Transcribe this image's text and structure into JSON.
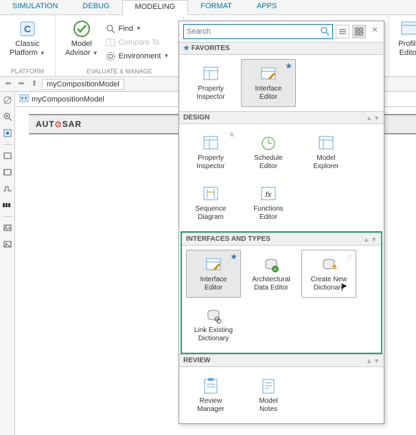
{
  "tabs": {
    "simulation": "SIMULATION",
    "debug": "DEBUG",
    "modeling": "MODELING",
    "format": "FORMAT",
    "apps": "APPS"
  },
  "ribbon": {
    "platform": {
      "classic": "Classic",
      "platform": "Platform",
      "group": "PLATFORM"
    },
    "model_advisor": {
      "line1": "Model",
      "line2": "Advisor"
    },
    "find": "Find",
    "compare": "Compare To",
    "environment": "Environment",
    "eval_group": "EVALUATE & MANAGE",
    "profile": {
      "line1": "Profile",
      "line2": "Editor"
    }
  },
  "nav": {
    "address": "myCompositionModel"
  },
  "doc": {
    "tab": "myCompositionModel",
    "autosar": "AUTOSAR"
  },
  "gallery": {
    "search_placeholder": "Search",
    "sections": {
      "favorites": {
        "title": "FAVORITES",
        "items": [
          {
            "label1": "Property",
            "label2": "Inspector"
          },
          {
            "label1": "Interface",
            "label2": "Editor"
          }
        ]
      },
      "design": {
        "title": "DESIGN",
        "items": [
          {
            "label1": "Property",
            "label2": "Inspector"
          },
          {
            "label1": "Schedule",
            "label2": "Editor"
          },
          {
            "label1": "Model",
            "label2": "Explorer"
          },
          {
            "label1": "Sequence",
            "label2": "Diagram"
          },
          {
            "label1": "Functions",
            "label2": "Editor"
          }
        ]
      },
      "interfaces": {
        "title": "INTERFACES AND TYPES",
        "items": [
          {
            "label1": "Interface",
            "label2": "Editor"
          },
          {
            "label1": "Architectural",
            "label2": "Data Editor"
          },
          {
            "label1": "Create New",
            "label2": "Dictionary"
          },
          {
            "label1": "Link Existing",
            "label2": "Dictionary"
          }
        ]
      },
      "review": {
        "title": "REVIEW",
        "items": [
          {
            "label1": "Review",
            "label2": "Manager"
          },
          {
            "label1": "Model",
            "label2": "Notes"
          }
        ]
      }
    }
  }
}
